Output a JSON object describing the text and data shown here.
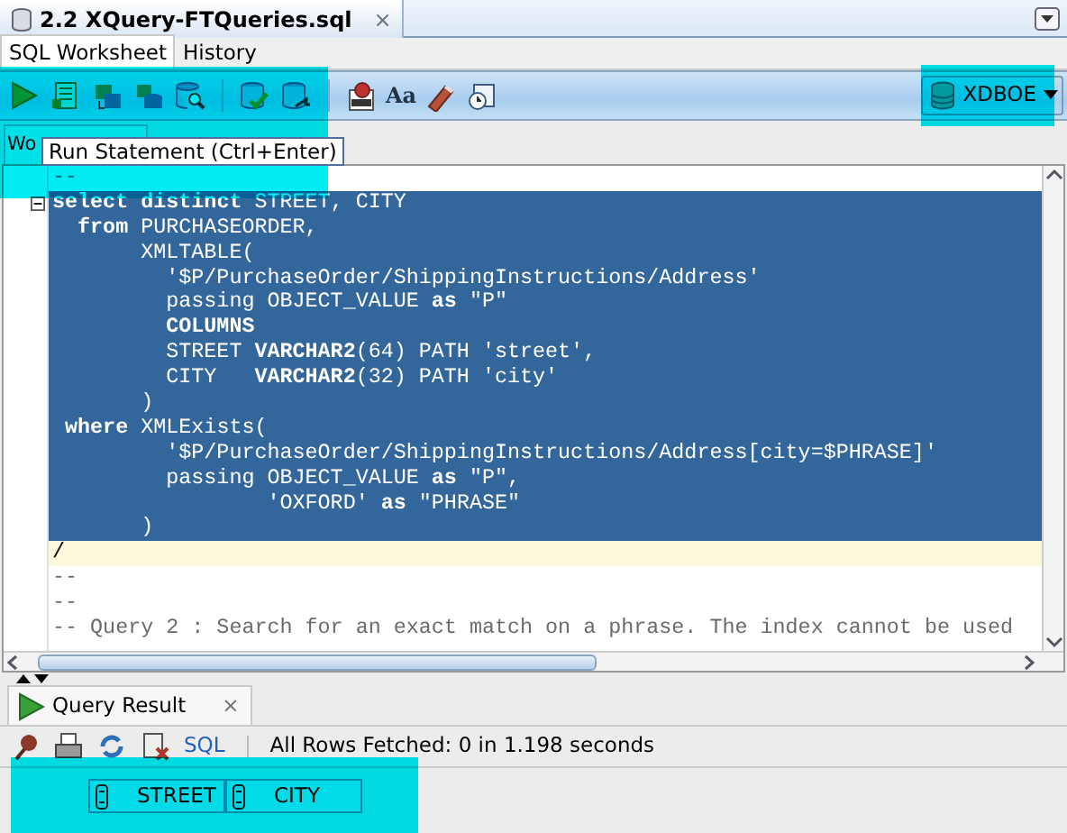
{
  "document_tab": {
    "title": "2.2 XQuery-FTQueries.sql",
    "close": "×"
  },
  "subtabs": [
    {
      "label": "SQL Worksheet",
      "selected": true
    },
    {
      "label": "History",
      "selected": false
    }
  ],
  "toolbar": {
    "font_button": "Aa",
    "connection": "XDBOE"
  },
  "worksheet_tab": "Wo",
  "tooltip": "Run Statement (Ctrl+Enter)",
  "code_lines": [
    {
      "text": "--",
      "kind": "comment",
      "selected": false,
      "fold": false
    },
    {
      "text": "**select** **distinct** STREET, CITY",
      "kind": "code",
      "selected": true,
      "fold": true
    },
    {
      "text": "  **from** PURCHASEORDER,",
      "kind": "code",
      "selected": true,
      "fold": false
    },
    {
      "text": "       XMLTABLE(",
      "kind": "code",
      "selected": true,
      "fold": false
    },
    {
      "text": "         '$P/PurchaseOrder/ShippingInstructions/Address'",
      "kind": "code",
      "selected": true,
      "fold": false
    },
    {
      "text": "         passing OBJECT_VALUE **as** \"P\"",
      "kind": "code",
      "selected": true,
      "fold": false
    },
    {
      "text": "         **COLUMNS**",
      "kind": "code",
      "selected": true,
      "fold": false
    },
    {
      "text": "         STREET **VARCHAR2**(64) PATH 'street',",
      "kind": "code",
      "selected": true,
      "fold": false
    },
    {
      "text": "         CITY   **VARCHAR2**(32) PATH 'city'",
      "kind": "code",
      "selected": true,
      "fold": false
    },
    {
      "text": "       )",
      "kind": "code",
      "selected": true,
      "fold": false
    },
    {
      "text": " **where** XMLExists(",
      "kind": "code",
      "selected": true,
      "fold": false
    },
    {
      "text": "         '$P/PurchaseOrder/ShippingInstructions/Address[city=$PHRASE]'",
      "kind": "code",
      "selected": true,
      "fold": false
    },
    {
      "text": "         passing OBJECT_VALUE **as** \"P\",",
      "kind": "code",
      "selected": true,
      "fold": false
    },
    {
      "text": "                 'OXFORD' **as** \"PHRASE\"",
      "kind": "code",
      "selected": true,
      "fold": false
    },
    {
      "text": "       )",
      "kind": "code",
      "selected": true,
      "fold": false
    },
    {
      "text": "/",
      "kind": "current",
      "selected": false,
      "fold": false
    },
    {
      "text": "--",
      "kind": "comment",
      "selected": false,
      "fold": false
    },
    {
      "text": "--",
      "kind": "comment",
      "selected": false,
      "fold": false
    },
    {
      "text": "-- Query 2 : Search for an exact match on a phrase. The index cannot be used",
      "kind": "comment",
      "selected": false,
      "fold": false
    }
  ],
  "result_tab": {
    "title": "Query Result",
    "close": "×"
  },
  "result_toolbar": {
    "sql_link": "SQL",
    "status": "All Rows Fetched: 0 in 1.198 seconds"
  },
  "result_columns": [
    "STREET",
    "CITY"
  ]
}
